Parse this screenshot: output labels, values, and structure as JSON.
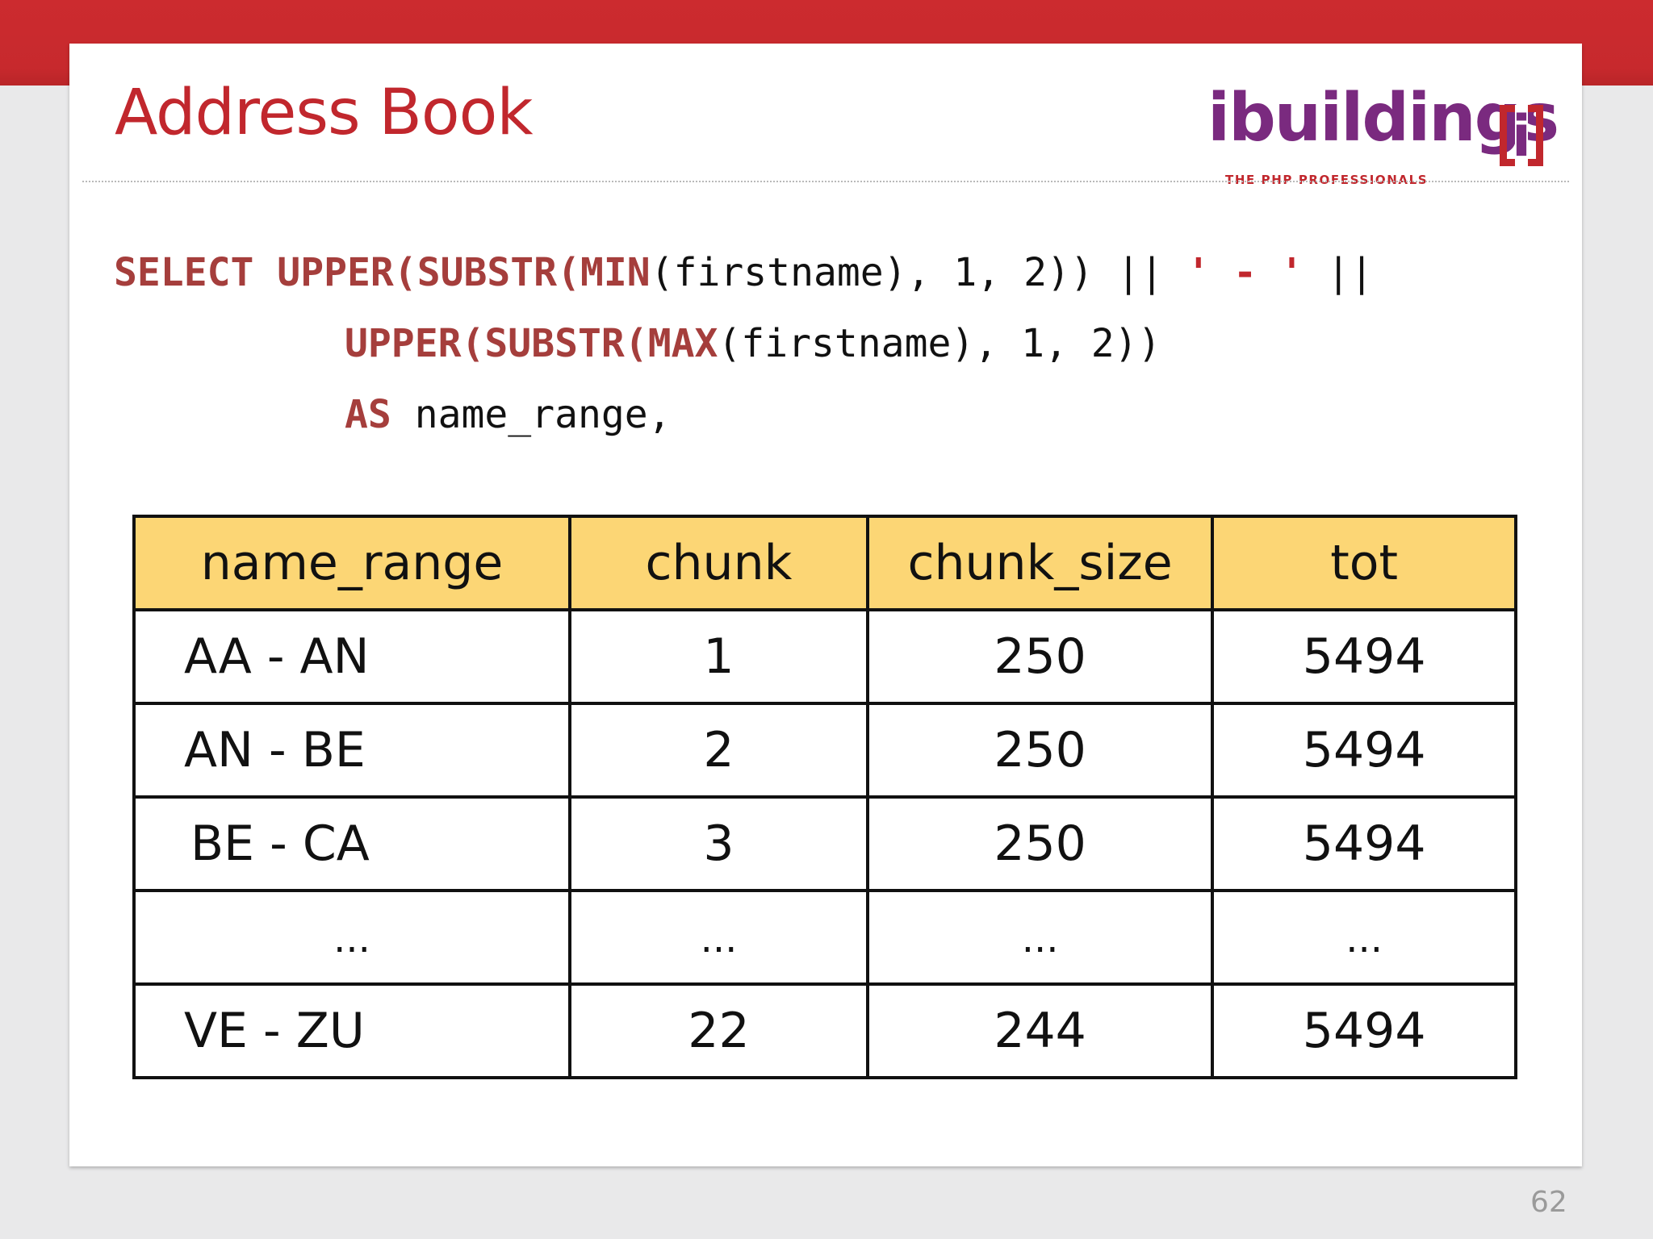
{
  "slide": {
    "title": "Address Book",
    "page_number": "62"
  },
  "logo": {
    "word": "ibuildings",
    "bracket_letter": "i",
    "tagline": "THE PHP PROFESSIONALS",
    "colors": {
      "word": "#7a2a7f",
      "accent": "#c1272d"
    }
  },
  "code": {
    "line1": {
      "select": "SELECT",
      "upper": "UPPER(",
      "substr": "SUBSTR(",
      "min": "MIN",
      "args": "(firstname), 1, 2))",
      "concat1": " || ",
      "literal": "' - '",
      "concat2": " ||"
    },
    "line2": {
      "upper": "UPPER(",
      "substr": "SUBSTR(",
      "max": "MAX",
      "args": "(firstname), 1, 2))"
    },
    "line3": {
      "as": "AS",
      "alias": " name_range,"
    },
    "ellipsis": "..."
  },
  "table": {
    "headers": [
      "name_range",
      "chunk",
      "chunk_size",
      "tot"
    ],
    "rows": [
      [
        "AA - AN",
        "1",
        "250",
        "5494"
      ],
      [
        "AN - BE",
        "2",
        "250",
        "5494"
      ],
      [
        "BE - CA",
        "3",
        "250",
        "5494"
      ],
      [
        "...",
        "...",
        "...",
        "..."
      ],
      [
        "VE - ZU",
        "22",
        "244",
        "5494"
      ]
    ]
  },
  "colors": {
    "band": "#c7292d",
    "title": "#c1272d",
    "keyword": "#a53e3c",
    "header_fill": "#fcd675"
  }
}
